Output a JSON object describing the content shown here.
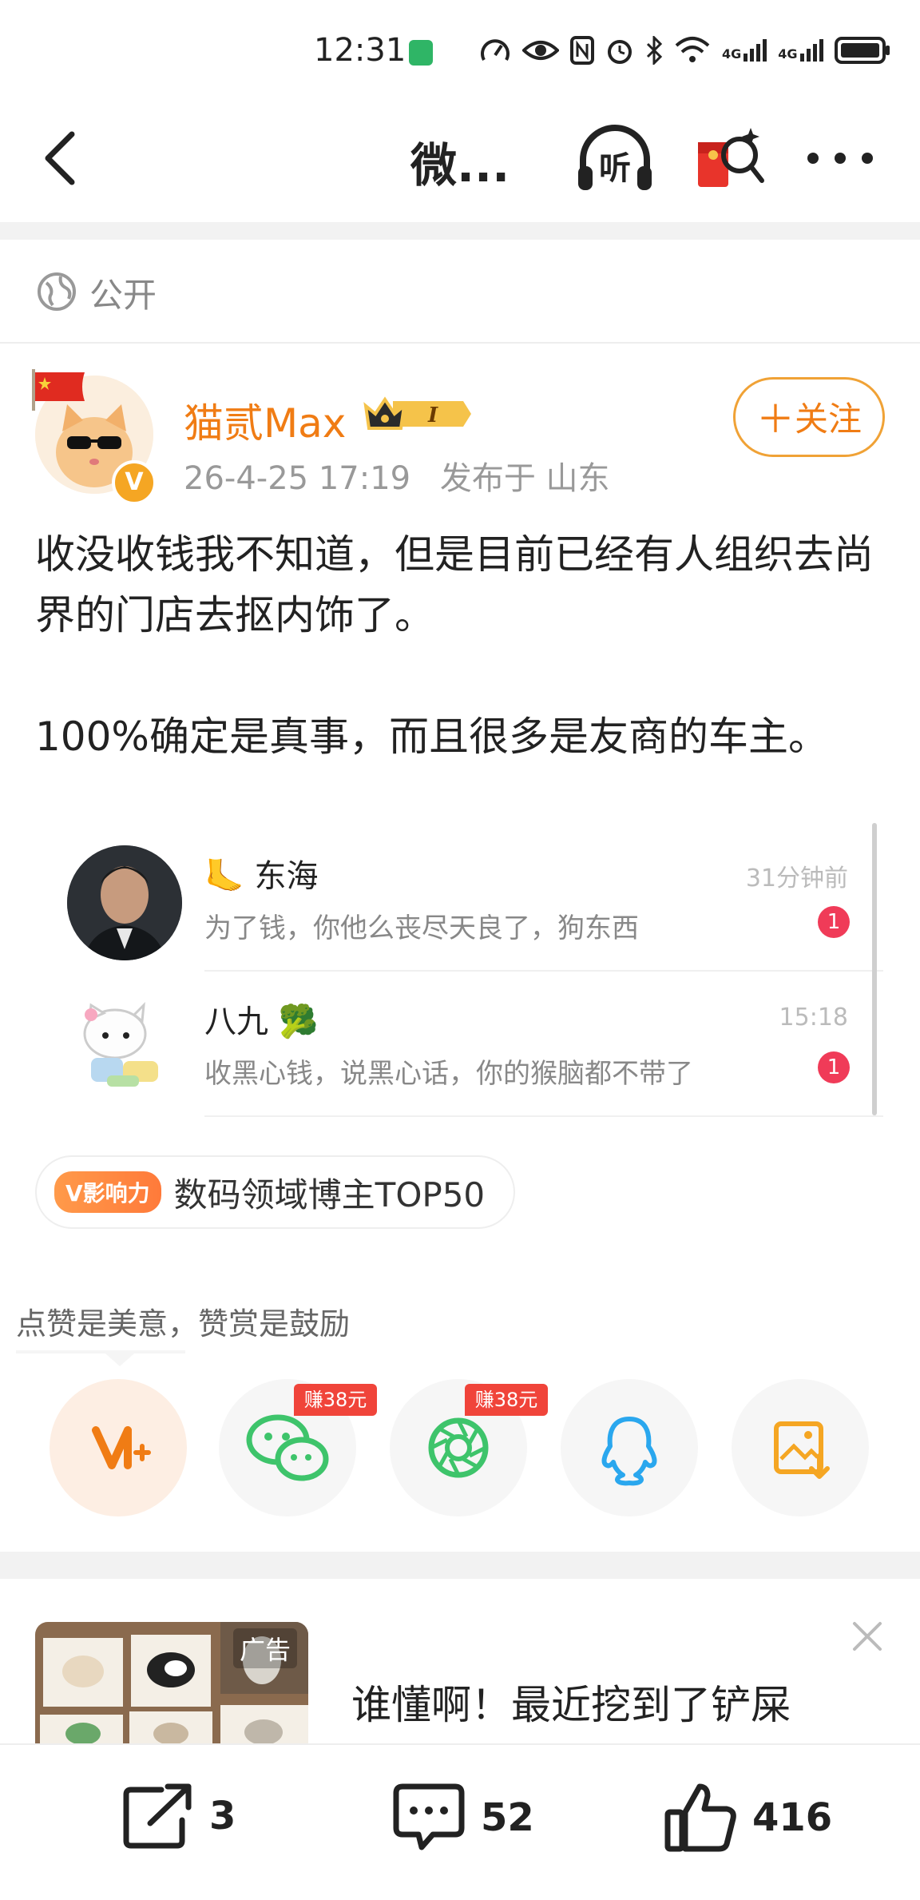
{
  "status_bar": {
    "time": "12:31",
    "net1": "4G",
    "net2": "4G"
  },
  "nav": {
    "title": "微...",
    "listen_label": "听"
  },
  "visibility": {
    "label": "公开"
  },
  "author": {
    "name": "猫贰Max",
    "time": "26-4-25 17:19",
    "location": "发布于 山东",
    "follow_label": "关注",
    "badge": "V",
    "level": "I"
  },
  "post": {
    "text": "收没收钱我不知道，但是目前已经有人组织去尚界的门店去抠内饰了。\n\n100%确定是真事，而且很多是友商的车主。"
  },
  "chat": {
    "items": [
      {
        "name": "东海",
        "message": "为了钱，你他么丧尽天良了，狗东西",
        "time": "31分钟前",
        "unread": "1"
      },
      {
        "name": "八九",
        "message": "收黑心钱，说黑心话，你的猴脑都不带了",
        "time": "15:18",
        "unread": "1"
      }
    ]
  },
  "influence": {
    "badge": "V影响力",
    "text": "数码领域博主TOP50"
  },
  "reward": {
    "hint": "点赞是美意，赞赏是鼓励"
  },
  "share": {
    "tag_wechat": "赚38元",
    "tag_moments": "赚38元"
  },
  "ad": {
    "label": "广告",
    "title": "谁懂啊！最近挖到了铲屎"
  },
  "actions": {
    "reposts": "3",
    "comments": "52",
    "likes": "416"
  },
  "colors": {
    "accent": "#f07c14",
    "badge_red": "#f03b58",
    "wechat_green": "#3ec46b",
    "qq_blue": "#2aa7ee"
  }
}
